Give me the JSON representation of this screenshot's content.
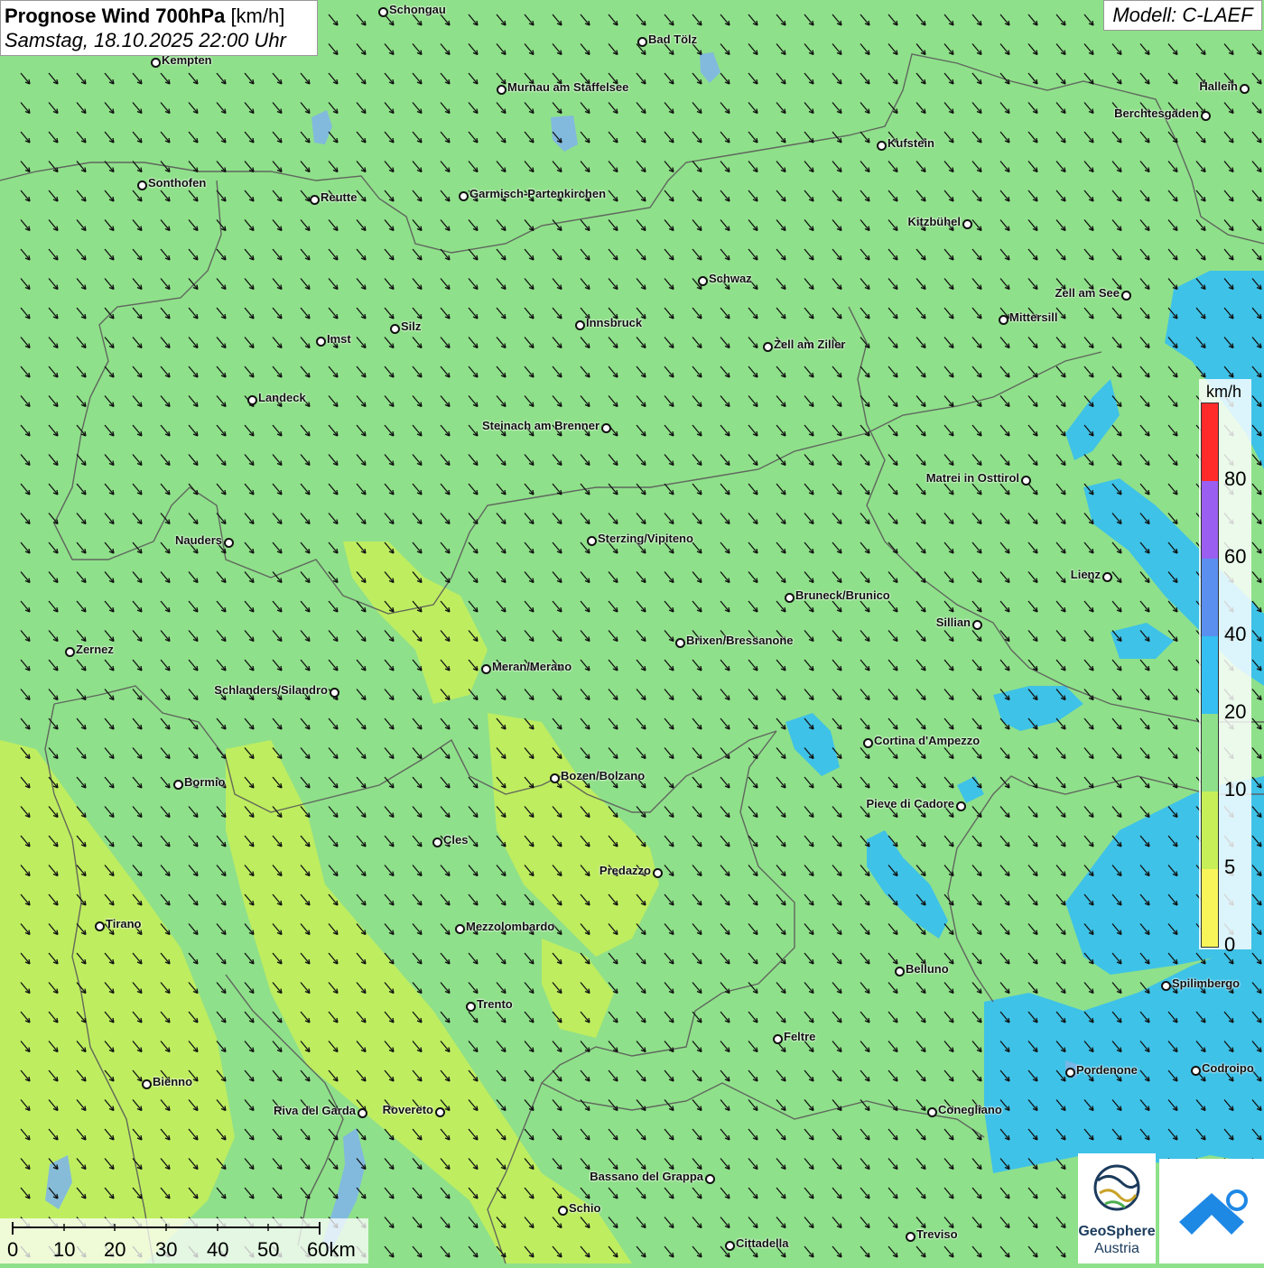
{
  "header": {
    "title_bold": "Prognose Wind 700hPa",
    "title_unit": "[km/h]",
    "datetime": "Samstag, 18.10.2025 22:00 Uhr",
    "model": "Modell: C-LAEF"
  },
  "legend": {
    "unit": "km/h",
    "ticks": [
      "80",
      "60",
      "40",
      "20",
      "10",
      "5",
      "0"
    ],
    "colors": [
      "#ff2a2a",
      "#9a5ef0",
      "#5a8ff0",
      "#36bff2",
      "#8fe08a",
      "#c7f058",
      "#f7f55a"
    ]
  },
  "scalebar": {
    "labels": [
      "0",
      "10",
      "20",
      "30",
      "40",
      "50",
      "60km"
    ]
  },
  "logos": {
    "geosphere_line1": "GeoSphere",
    "geosphere_line2": "Austria"
  },
  "colors": {
    "base_field": "#8fe08a",
    "calm_field": "#c7f058",
    "strong_field": "#36bff2",
    "borders": "#5a5a5a",
    "arrows": "#111111"
  },
  "wind": {
    "direction": "from north-west towards south-east"
  },
  "cities": [
    {
      "name": "Schongau"
    },
    {
      "name": "Bad Tölz"
    },
    {
      "name": "Kempten"
    },
    {
      "name": "Murnau am Staffelsee"
    },
    {
      "name": "Hallein"
    },
    {
      "name": "Berchtesgaden"
    },
    {
      "name": "Kufstein"
    },
    {
      "name": "Sonthofen"
    },
    {
      "name": "Reutte"
    },
    {
      "name": "Garmisch-Partenkirchen"
    },
    {
      "name": "Kitzbühel"
    },
    {
      "name": "Schwaz"
    },
    {
      "name": "Zell am See"
    },
    {
      "name": "Mittersill"
    },
    {
      "name": "Innsbruck"
    },
    {
      "name": "Silz"
    },
    {
      "name": "Imst"
    },
    {
      "name": "Zell am Ziller"
    },
    {
      "name": "Landeck"
    },
    {
      "name": "Steinach am Brenner"
    },
    {
      "name": "Matrei in Osttirol"
    },
    {
      "name": "Nauders"
    },
    {
      "name": "Sterzing/Vipiteno"
    },
    {
      "name": "Lienz"
    },
    {
      "name": "Bruneck/Brunico"
    },
    {
      "name": "Sillian"
    },
    {
      "name": "Zernez"
    },
    {
      "name": "Brixen/Bressanone"
    },
    {
      "name": "Meran/Merano"
    },
    {
      "name": "Schlanders/Silandro"
    },
    {
      "name": "Cortina d'Ampezzo"
    },
    {
      "name": "Bormio"
    },
    {
      "name": "Bozen/Bolzano"
    },
    {
      "name": "Pieve di Cadore"
    },
    {
      "name": "Cles"
    },
    {
      "name": "Predazzo"
    },
    {
      "name": "Tirano"
    },
    {
      "name": "Mezzolombardo"
    },
    {
      "name": "Belluno"
    },
    {
      "name": "Spilimbergo"
    },
    {
      "name": "Trento"
    },
    {
      "name": "Feltre"
    },
    {
      "name": "Pordenone"
    },
    {
      "name": "Codroipo"
    },
    {
      "name": "Bienno"
    },
    {
      "name": "Riva del Garda"
    },
    {
      "name": "Rovereto"
    },
    {
      "name": "Conegliano"
    },
    {
      "name": "Bassano del Grappa"
    },
    {
      "name": "Schio"
    },
    {
      "name": "Treviso"
    },
    {
      "name": "Cittadella"
    }
  ]
}
